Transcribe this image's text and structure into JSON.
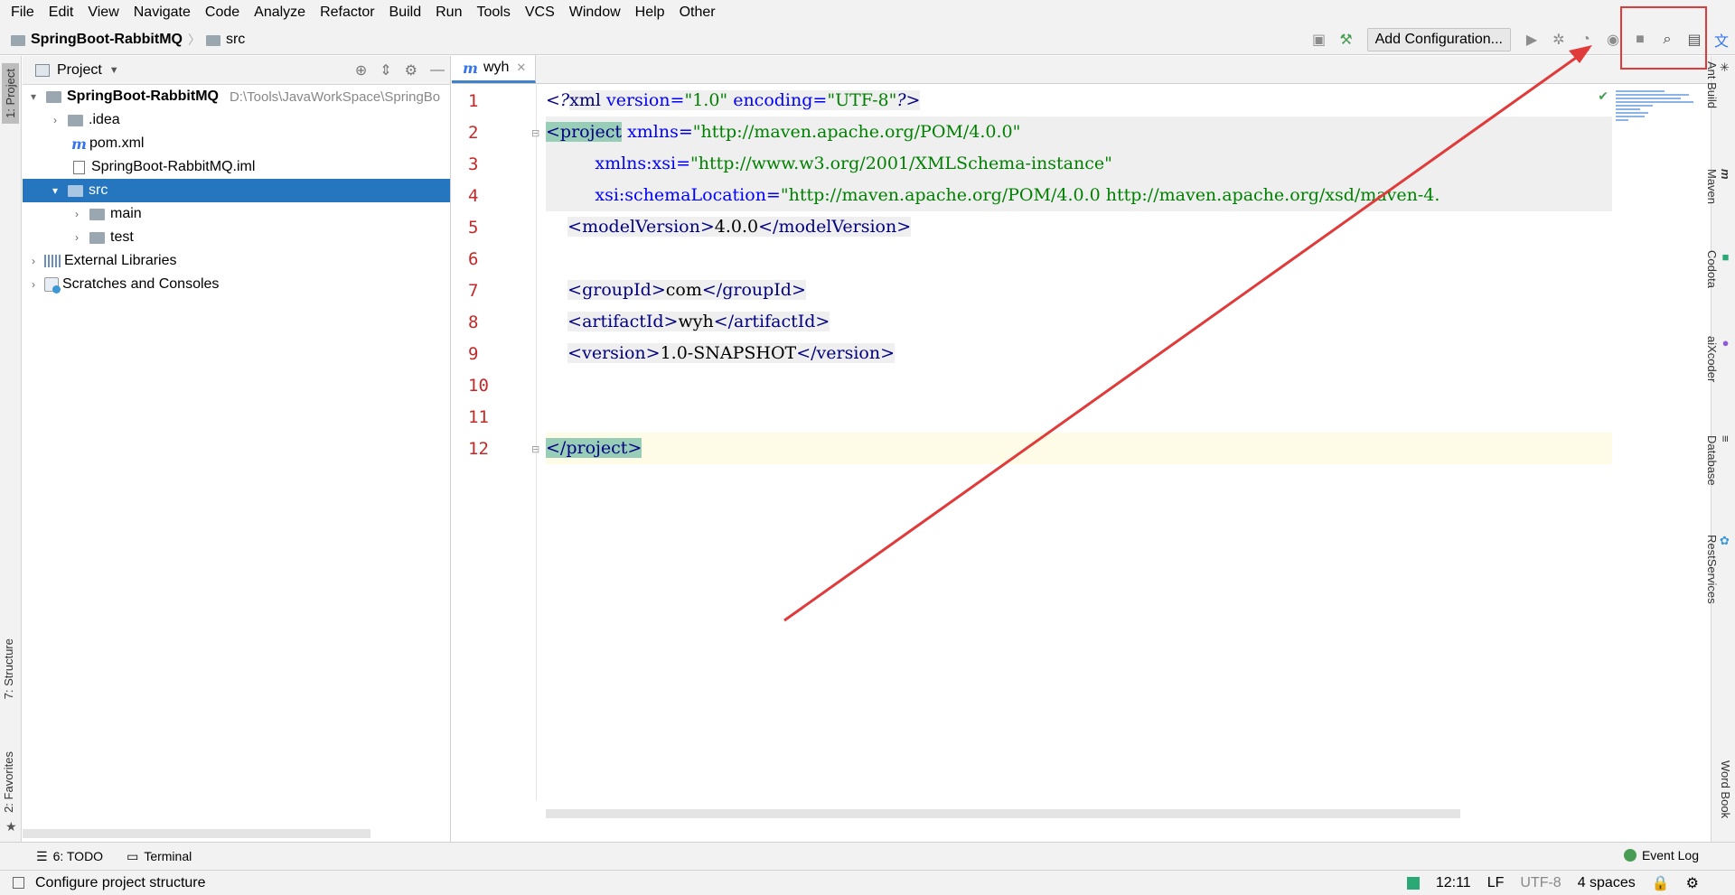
{
  "menu": [
    "File",
    "Edit",
    "View",
    "Navigate",
    "Code",
    "Analyze",
    "Refactor",
    "Build",
    "Run",
    "Tools",
    "VCS",
    "Window",
    "Help",
    "Other"
  ],
  "breadcrumb": {
    "project": "SpringBoot-RabbitMQ",
    "folder": "src"
  },
  "toolbar": {
    "add_config": "Add Configuration..."
  },
  "left_tabs": {
    "project": "1: Project",
    "structure": "7: Structure",
    "favorites": "2: Favorites"
  },
  "right_tabs": {
    "ant": "Ant Build",
    "maven": "Maven",
    "codota": "Codota",
    "aixcoder": "aiXcoder",
    "database": "Database",
    "rest": "RestServices",
    "wordbook": "Word Book"
  },
  "project_panel": {
    "title": "Project",
    "root_name": "SpringBoot-RabbitMQ",
    "root_path": "D:\\Tools\\JavaWorkSpace\\SpringBo",
    "items": [
      {
        "label": ".idea"
      },
      {
        "label": "pom.xml"
      },
      {
        "label": "SpringBoot-RabbitMQ.iml"
      },
      {
        "label": "src"
      },
      {
        "label": "main"
      },
      {
        "label": "test"
      },
      {
        "label": "External Libraries"
      },
      {
        "label": "Scratches and Consoles"
      }
    ]
  },
  "editor": {
    "tab": "wyh",
    "line_numbers": [
      "1",
      "2",
      "3",
      "4",
      "5",
      "6",
      "7",
      "8",
      "9",
      "10",
      "11",
      "12"
    ],
    "code": {
      "l1": {
        "open": "<?",
        "name": "xml",
        "a1": " version=",
        "v1": "\"1.0\"",
        "a2": " encoding=",
        "v2": "\"UTF-8\"",
        "close": "?>"
      },
      "l2": {
        "tag": "<project",
        "attr": "xmlns=",
        "val": "\"http://maven.apache.org/POM/4.0.0\""
      },
      "l3": {
        "attr": "xmlns:xsi=",
        "val": "\"http://www.w3.org/2001/XMLSchema-instance\""
      },
      "l4": {
        "attr": "xsi:schemaLocation=",
        "val": "\"http://maven.apache.org/POM/4.0.0 http://maven.apache.org/xsd/maven-4."
      },
      "l5": {
        "open": "<modelVersion>",
        "text": "4.0.0",
        "close": "</modelVersion>"
      },
      "l7": {
        "open": "<groupId>",
        "text": "com",
        "close": "</groupId>"
      },
      "l8": {
        "open": "<artifactId>",
        "text": "wyh",
        "close": "</artifactId>"
      },
      "l9": {
        "open": "<version>",
        "text": "1.0-SNAPSHOT",
        "close": "</version>"
      },
      "l12": {
        "close": "</project>"
      }
    }
  },
  "bottom_bar": {
    "todo": "6: TODO",
    "terminal": "Terminal",
    "event_log": "Event Log"
  },
  "status": {
    "message": "Configure project structure",
    "position": "12:11",
    "line_sep": "LF",
    "encoding": "UTF-8",
    "indent": "4 spaces"
  },
  "colors": {
    "selection": "#2675bf",
    "annotation": "#e03a3a",
    "line_number": "#c62828"
  }
}
